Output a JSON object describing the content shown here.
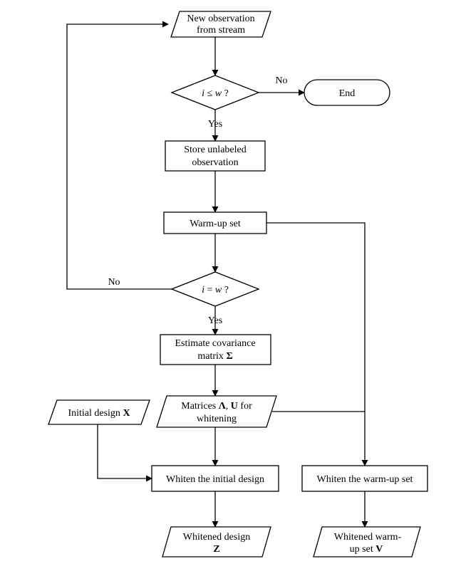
{
  "nodes": {
    "start": {
      "line1": "New observation",
      "line2": "from stream"
    },
    "cond1": {
      "text": "<tspan font-style='italic'>i</tspan> ≤ <tspan font-style='italic'>w</tspan> ?"
    },
    "end": {
      "text": "End"
    },
    "store": {
      "line1": "Store unlabeled",
      "line2": "observation"
    },
    "warmup": {
      "text": "Warm-up set"
    },
    "cond2": {
      "text": "<tspan font-style='italic'>i</tspan> = <tspan font-style='italic'>w</tspan> ?"
    },
    "estimate": {
      "line1": "Estimate covariance",
      "line2html": "matrix <tspan class='bold-sym'>Σ</tspan>"
    },
    "matrices": {
      "line1html": "Matrices <tspan class='bold-sym'>Λ</tspan>, <tspan class='bold-sym'>U</tspan> for",
      "line2": "whitening"
    },
    "initial": {
      "texthtml": "Initial design <tspan class='bold-sym'>X</tspan>"
    },
    "whitenInit": {
      "text": "Whiten the initial design"
    },
    "whitenWarm": {
      "text": "Whiten the warm-up set"
    },
    "whitenedZ": {
      "line1html": "Whitened design",
      "line2html": "<tspan class='bold-sym'>Z</tspan>"
    },
    "whitenedV": {
      "line1": "Whitened warm-",
      "line2html": "up set  <tspan class='bold-sym'>V</tspan>"
    }
  },
  "edges": {
    "yes1": "Yes",
    "no1": "No",
    "yes2": "Yes",
    "no2": "No"
  }
}
